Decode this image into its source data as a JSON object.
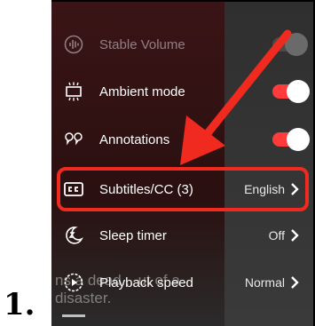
{
  "step": {
    "number": "1."
  },
  "video": {
    "caption_text": "ns a dead... ut of a disaster."
  },
  "settings_menu": {
    "items": [
      {
        "label": "Stable Volume",
        "control": "toggle",
        "state": "off",
        "icon": "stable-volume-icon"
      },
      {
        "label": "Ambient mode",
        "control": "toggle",
        "state": "on",
        "icon": "ambient-mode-icon"
      },
      {
        "label": "Annotations",
        "control": "toggle",
        "state": "on",
        "icon": "annotations-icon"
      },
      {
        "label": "Subtitles/CC (3)",
        "value": "English",
        "control": "submenu",
        "icon": "subtitles-cc-icon"
      },
      {
        "label": "Sleep timer",
        "value": "Off",
        "control": "submenu",
        "icon": "sleep-timer-icon"
      },
      {
        "label": "Playback speed",
        "value": "Normal",
        "control": "submenu",
        "icon": "playback-speed-icon"
      }
    ]
  },
  "colors": {
    "accent": "#f02a1e",
    "toggle_on": "#ff3b3b",
    "menu_text": "#ffffff"
  }
}
